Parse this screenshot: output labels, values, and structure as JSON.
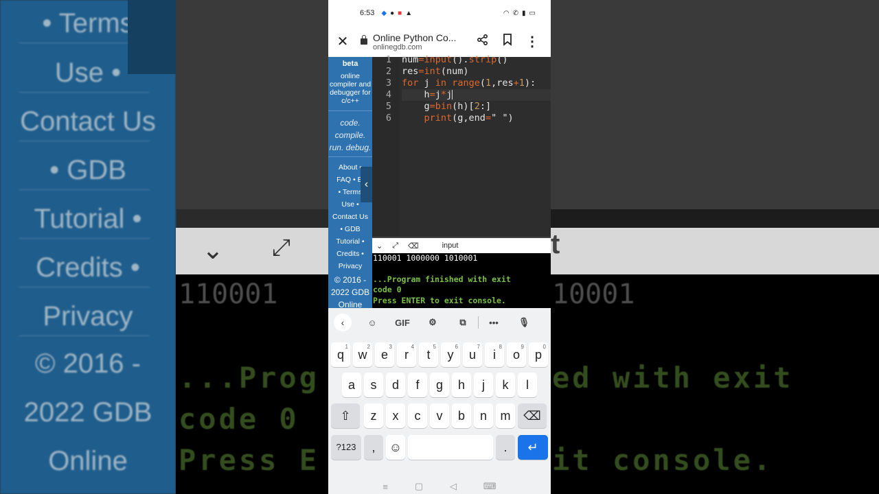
{
  "status_bar": {
    "time": "6:53",
    "notification_icons": [
      "tool-icon",
      "snapchat-icon",
      "message-icon",
      "warning-icon"
    ],
    "right_icons": [
      "wifi-icon",
      "phone-wifi-icon",
      "signal-icon",
      "battery-icon"
    ]
  },
  "browser": {
    "title": "Online Python Co...",
    "url": "onlinegdb.com",
    "close_label": "✕",
    "share_label": "⤴",
    "bookmark_label": "▯",
    "menu_label": "⋮"
  },
  "sidebar": {
    "brand": "beta",
    "description": "online compiler and debugger for c/c++",
    "motto": [
      "code.",
      "compile.",
      "run. debug."
    ],
    "links": [
      "About •",
      "FAQ • Bl",
      "• Terms",
      "Use •",
      "Contact Us",
      "• GDB",
      "Tutorial •",
      "Credits •",
      "Privacy"
    ],
    "copyright": [
      "© 2016 -",
      "2022 GDB",
      "Online"
    ],
    "collapse_label": "‹"
  },
  "editor": {
    "line_numbers": [
      "1",
      "2",
      "3",
      "4",
      "5",
      "6"
    ]
  },
  "console_toolbar": {
    "label": "input"
  },
  "console": {
    "output": "110001 1000000 1010001",
    "finished_line1": "...Program finished with exit",
    "finished_line2": "code 0",
    "finished_line3": "Press ENTER to exit console."
  },
  "keyboard": {
    "suggestion_icons": [
      "back-icon",
      "sticker-icon",
      "gif",
      "settings-icon",
      "translate-icon",
      "more-icon",
      "mic-icon"
    ],
    "gif_label": "GIF",
    "row1": [
      {
        "k": "q",
        "h": "1"
      },
      {
        "k": "w",
        "h": "2"
      },
      {
        "k": "e",
        "h": "3"
      },
      {
        "k": "r",
        "h": "4"
      },
      {
        "k": "t",
        "h": "5"
      },
      {
        "k": "y",
        "h": "6"
      },
      {
        "k": "u",
        "h": "7"
      },
      {
        "k": "i",
        "h": "8"
      },
      {
        "k": "o",
        "h": "9"
      },
      {
        "k": "p",
        "h": "0"
      }
    ],
    "row2": [
      "a",
      "s",
      "d",
      "f",
      "g",
      "h",
      "j",
      "k",
      "l"
    ],
    "row3": [
      "z",
      "x",
      "c",
      "v",
      "b",
      "n",
      "m"
    ],
    "sym_label": "?123",
    "comma_label": ",",
    "period_label": ".",
    "shift_label": "⇧",
    "backspace_label": "⌫",
    "emoji_label": "☺",
    "enter_label": "↵"
  },
  "background": {
    "left_lines": [
      "• Terms",
      "Use •",
      "Contact Us",
      "• GDB",
      "Tutorial •",
      "Credits •",
      "Privacy",
      "© 2016 -",
      "2022 GDB",
      "Online"
    ],
    "right_output": "10001",
    "right_t": "t",
    "left_output": "110001",
    "green_left": [
      "...Prog",
      "code 0",
      "Press E"
    ],
    "green_right": [
      "ed with exit",
      "",
      "it console."
    ]
  }
}
